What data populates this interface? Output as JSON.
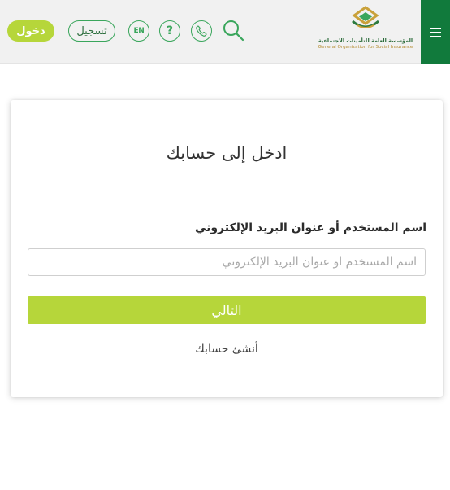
{
  "header": {
    "logo": {
      "org_name_ar": "المؤسسة العامة للتأمينات الاجتماعية",
      "org_name_en": "General Organization for Social Insurance"
    },
    "menu_icon": "hamburger-menu-icon",
    "search_icon": "search-icon",
    "phone_icon": "phone-icon",
    "help_icon": "question-mark-icon",
    "help_label": "?",
    "language_label": "EN",
    "register_label": "تسجيل",
    "login_label": "دخول"
  },
  "login_card": {
    "title": "ادخل إلى حسابك",
    "username_label": "اسم المستخدم أو عنوان البريد الإلكتروني",
    "username_placeholder": "اسم المستخدم أو عنوان البريد الإلكتروني",
    "username_value": "",
    "next_label": "التالي",
    "create_account_label": "أنشئ حسابك"
  },
  "colors": {
    "brand_green": "#117a3c",
    "accent_lime": "#b6d63a",
    "icon_green": "#3aa65c"
  }
}
